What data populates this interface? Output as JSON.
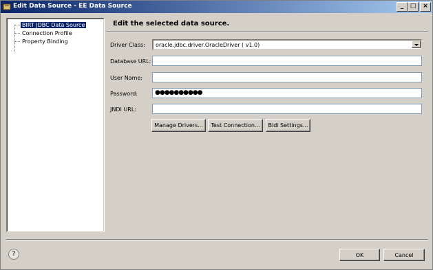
{
  "window": {
    "title": "Edit Data Source - EE Data Source",
    "minimize_label": "_",
    "maximize_label": "□",
    "close_label": "×"
  },
  "tree": {
    "items": [
      {
        "label": "BIRT JDBC Data Source",
        "selected": true
      },
      {
        "label": "Connection Profile",
        "selected": false
      },
      {
        "label": "Property Binding",
        "selected": false
      }
    ]
  },
  "main": {
    "heading": "Edit the selected data source."
  },
  "form": {
    "driver_class": {
      "label": "Driver Class:",
      "value": "oracle.jdbc.driver.OracleDriver ( v1.0)"
    },
    "database_url": {
      "label": "Database URL:",
      "value": ""
    },
    "user_name": {
      "label": "User Name:",
      "value": ""
    },
    "password": {
      "label": "Password:",
      "value": "●●●●●●●●●●"
    },
    "jndi_url": {
      "label": "JNDI URL:",
      "value": ""
    }
  },
  "buttons": {
    "manage_drivers": "Manage Drivers...",
    "test_connection": "Test Connection...",
    "bidi_settings": "Bidi Settings...",
    "ok": "OK",
    "cancel": "Cancel",
    "help": "?"
  },
  "icons": {
    "window": "app-icon",
    "help": "help-icon",
    "dropdown": "chevron-down-icon"
  },
  "colors": {
    "titlebar_start": "#0a246a",
    "titlebar_end": "#a6caf0",
    "dialog_bg": "#d4d0c8",
    "selection": "#0a246a"
  }
}
